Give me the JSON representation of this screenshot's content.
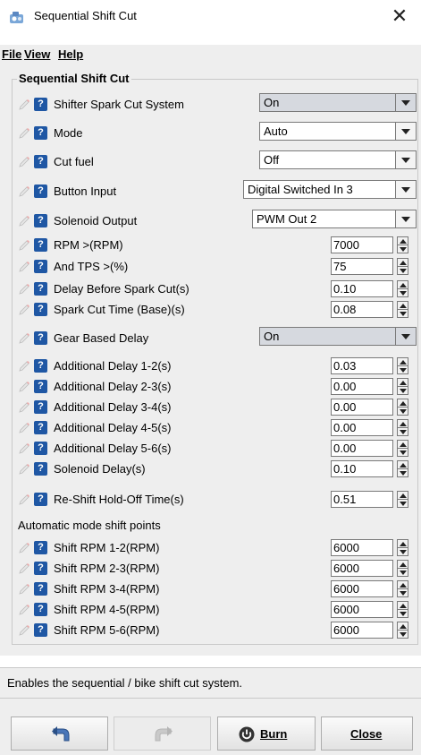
{
  "window": {
    "title": "Sequential Shift Cut",
    "close_glyph": "✕"
  },
  "menu": [
    {
      "label": "File",
      "accel": "F"
    },
    {
      "label": "View",
      "accel": "V"
    },
    {
      "label": "Help",
      "accel": "H"
    }
  ],
  "group": {
    "title": "Sequential Shift Cut"
  },
  "fields": [
    {
      "label": "Shifter Spark Cut System",
      "type": "combo",
      "value": "On"
    },
    {
      "label": "Mode",
      "type": "combo",
      "value": "Auto"
    },
    {
      "label": "Cut fuel",
      "type": "combo",
      "value": "Off"
    },
    {
      "label": "Button Input",
      "type": "combo",
      "value": "Digital Switched In 3"
    },
    {
      "label": "Solenoid Output",
      "type": "combo",
      "value": "PWM Out 2"
    },
    {
      "label": "RPM >(RPM)",
      "type": "spin",
      "value": "7000"
    },
    {
      "label": "And TPS >(%)",
      "type": "spin",
      "value": "75"
    },
    {
      "label": "Delay Before Spark Cut(s)",
      "type": "spin",
      "value": "0.10"
    },
    {
      "label": "Spark Cut Time (Base)(s)",
      "type": "spin",
      "value": "0.08"
    },
    {
      "label": "Gear Based Delay",
      "type": "combo",
      "value": "On"
    },
    {
      "label": "Additional Delay 1-2(s)",
      "type": "spin",
      "value": "0.03"
    },
    {
      "label": "Additional Delay 2-3(s)",
      "type": "spin",
      "value": "0.00"
    },
    {
      "label": "Additional Delay 3-4(s)",
      "type": "spin",
      "value": "0.00"
    },
    {
      "label": "Additional Delay 4-5(s)",
      "type": "spin",
      "value": "0.00"
    },
    {
      "label": "Additional Delay 5-6(s)",
      "type": "spin",
      "value": "0.00"
    },
    {
      "label": "Solenoid Delay(s)",
      "type": "spin",
      "value": "0.10"
    },
    {
      "label": "Re-Shift Hold-Off Time(s)",
      "type": "spin",
      "value": "0.51"
    }
  ],
  "shift_points_label": "Automatic mode shift points",
  "shift_points": [
    {
      "label": "Shift RPM 1-2(RPM)",
      "value": "6000"
    },
    {
      "label": "Shift RPM 2-3(RPM)",
      "value": "6000"
    },
    {
      "label": "Shift RPM 3-4(RPM)",
      "value": "6000"
    },
    {
      "label": "Shift RPM 4-5(RPM)",
      "value": "6000"
    },
    {
      "label": "Shift RPM 5-6(RPM)",
      "value": "6000"
    }
  ],
  "help_glyph": "?",
  "status": "Enables the sequential / bike shift cut system.",
  "buttons": {
    "undo_icon": "undo-icon",
    "redo_icon": "redo-icon",
    "burn_label": "Burn",
    "close_label": "Close"
  }
}
